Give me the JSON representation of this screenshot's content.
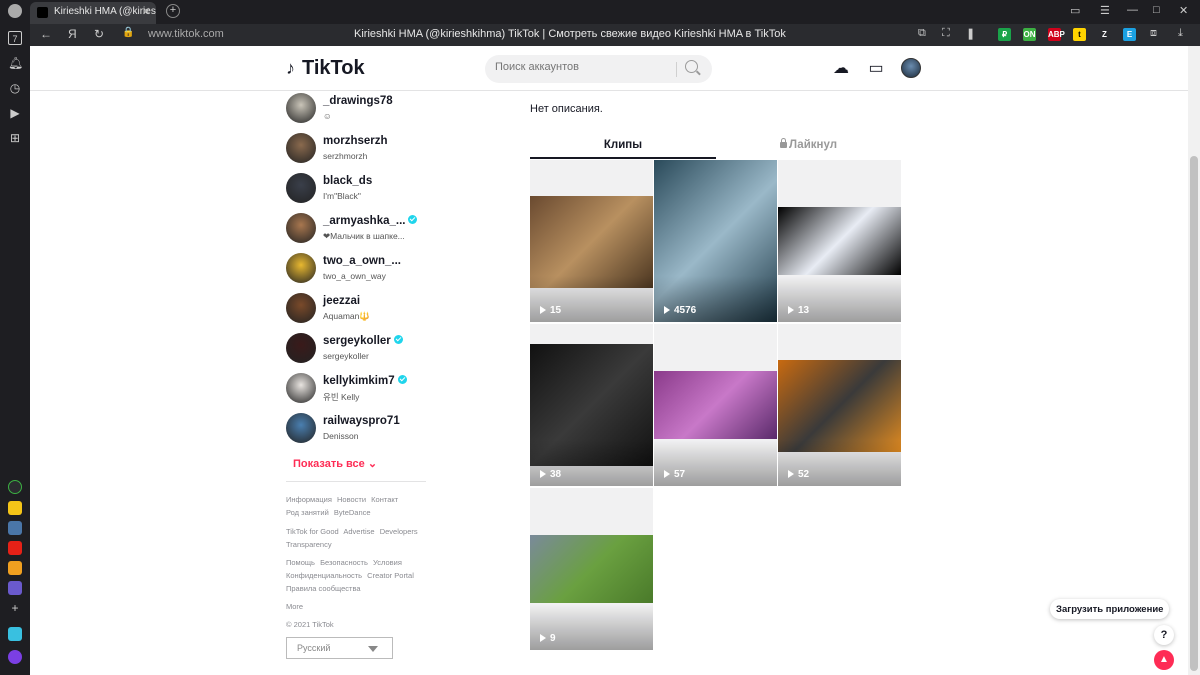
{
  "browser": {
    "tab_title": "Kirieshki HMA (@kiriesh",
    "tab_close": "✕",
    "new_tab": "+",
    "url": "www.tiktok.com",
    "page_title": "Kirieshki HMA (@kirieshkihma) TikTok | Смотреть свежие видео Kirieshki HMA в TikTok",
    "sidebar_counter": "7",
    "extensions": [
      {
        "name": "ruble-ext",
        "label": "₽",
        "color": "#1aa34a"
      },
      {
        "name": "on-ext",
        "label": "ON",
        "color": "#3cb043"
      },
      {
        "name": "abp-ext",
        "label": "ABP",
        "color": "#d0021b"
      },
      {
        "name": "t-ext",
        "label": "t",
        "color": "#ffd400"
      },
      {
        "name": "z-ext",
        "label": "Z",
        "color": "#2a2b2f"
      },
      {
        "name": "e-ext",
        "label": "E",
        "color": "#1ba1e2"
      }
    ]
  },
  "header": {
    "logo_text": "TikTok",
    "search_placeholder": "Поиск аккаунтов"
  },
  "following": [
    {
      "username": "_drawings78",
      "nickname": "☺",
      "verified": false,
      "avatar_color": "#c9c4b8"
    },
    {
      "username": "morzhserzh",
      "nickname": "serzhmorzh",
      "verified": false,
      "avatar_color": "#8a6a4e"
    },
    {
      "username": "black_ds",
      "nickname": "I'm\"Black\"",
      "verified": false,
      "avatar_color": "#3a3f4a"
    },
    {
      "username": "_armyashka_...",
      "nickname": "❤Мальчик в шапке...",
      "verified": true,
      "avatar_color": "#a8774f"
    },
    {
      "username": "two_a_own_...",
      "nickname": "two_a_own_way",
      "verified": false,
      "avatar_color": "#e8b830"
    },
    {
      "username": "jeezzai",
      "nickname": "Aquaman🔱",
      "verified": false,
      "avatar_color": "#7a4a2a"
    },
    {
      "username": "sergeykoller",
      "nickname": "sergeykoller",
      "verified": true,
      "avatar_color": "#3a1a1a"
    },
    {
      "username": "kellykimkim7",
      "nickname": "유빈 Kelly",
      "verified": true,
      "avatar_color": "#e8e4e0"
    },
    {
      "username": "railwayspro71",
      "nickname": "Denisson",
      "verified": false,
      "avatar_color": "#4a7fb0"
    }
  ],
  "show_all": "Показать все",
  "footer": {
    "row1": [
      "Информация",
      "Новости",
      "Контакт"
    ],
    "row2": [
      "Род занятий",
      "ByteDance"
    ],
    "row3": [
      "TikTok for Good",
      "Advertise",
      "Developers"
    ],
    "row4": [
      "Transparency"
    ],
    "row5": [
      "Помощь",
      "Безопасность",
      "Условия"
    ],
    "row6": [
      "Конфиденциальность",
      "Creator Portal"
    ],
    "row7": [
      "Правила сообщества"
    ],
    "more": "More",
    "copyright": "© 2021 TikTok",
    "language": "Русский"
  },
  "profile": {
    "stats_stub": "·· ··· ··· ··· ··· ··· ···",
    "description": "Нет описания.",
    "tab_clips": "Клипы",
    "tab_liked": "Лайкнул"
  },
  "videos": [
    {
      "views": "15",
      "colors": [
        "#6a4a30",
        "#b89060",
        "#4a3520"
      ]
    },
    {
      "views": "4576",
      "colors": [
        "#2a4a5a",
        "#9ab8c8",
        "#1f3a48"
      ]
    },
    {
      "views": "13",
      "colors": [
        "#000000",
        "#e8ecf4",
        "#000000"
      ]
    },
    {
      "views": "38",
      "colors": [
        "#111111",
        "#3a3a3a",
        "#111111"
      ]
    },
    {
      "views": "57",
      "colors": [
        "#8a3a8a",
        "#c878c8",
        "#5a2a6a"
      ]
    },
    {
      "views": "52",
      "colors": [
        "#c86a10",
        "#3a3a3a",
        "#e08a20"
      ]
    },
    {
      "views": "9",
      "colors": [
        "#7a8a9a",
        "#6aa040",
        "#4a7a2a"
      ]
    }
  ],
  "floating": {
    "get_app": "Загрузить приложение",
    "help": "?"
  }
}
